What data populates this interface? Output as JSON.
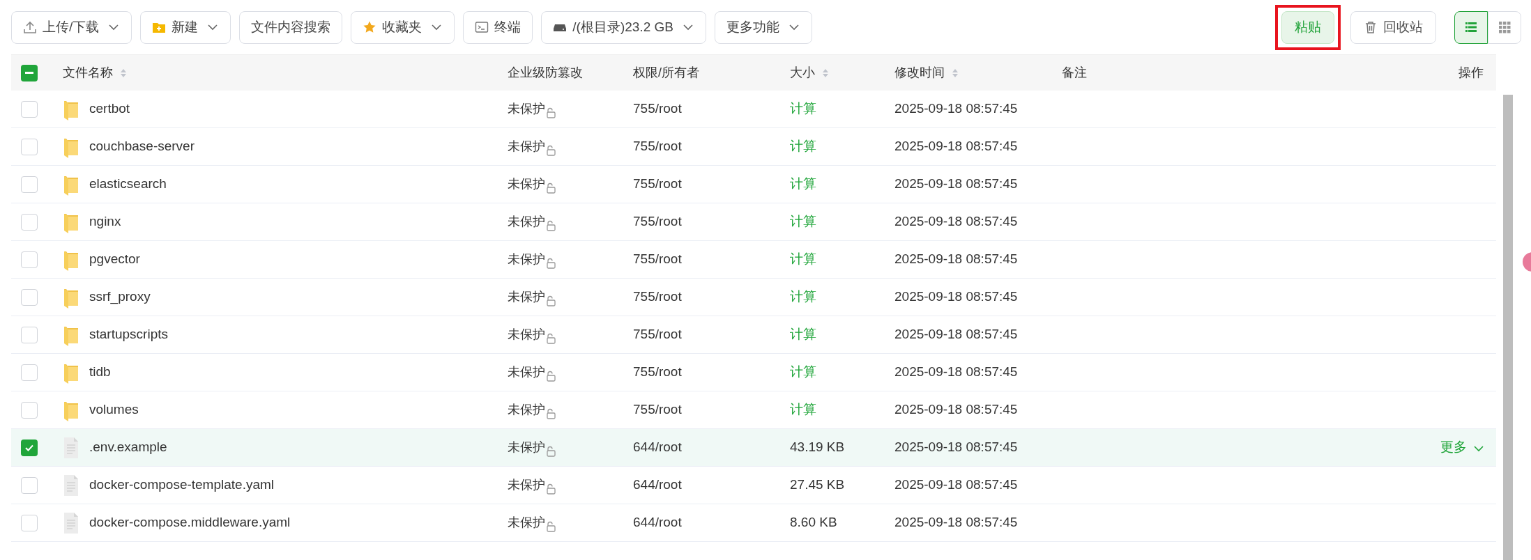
{
  "toolbar": {
    "left": [
      {
        "kind": "upload",
        "label": "上传/下载",
        "dropdown": true
      },
      {
        "kind": "new",
        "label": "新建",
        "dropdown": true
      },
      {
        "kind": "plain",
        "label": "文件内容搜索",
        "dropdown": false
      },
      {
        "kind": "star",
        "label": "收藏夹",
        "dropdown": true
      },
      {
        "kind": "terminal",
        "label": "终端",
        "dropdown": false
      },
      {
        "kind": "disk",
        "label": "/(根目录)23.2 GB",
        "dropdown": true
      },
      {
        "kind": "plain",
        "label": "更多功能",
        "dropdown": true
      }
    ],
    "paste": {
      "label": "粘贴",
      "highlighted": true
    },
    "trash": {
      "label": "回收站"
    },
    "views": [
      {
        "kind": "list",
        "selected": true
      },
      {
        "kind": "grid",
        "selected": false
      }
    ]
  },
  "table": {
    "select_all": {
      "indeterminate": true
    },
    "columns": [
      {
        "label": "文件名称",
        "sortable": true
      },
      {
        "label": "企业级防篡改",
        "sortable": false
      },
      {
        "label": "权限/所有者",
        "sortable": false
      },
      {
        "label": "大小",
        "sortable": true
      },
      {
        "label": "修改时间",
        "sortable": true
      },
      {
        "label": "备注",
        "sortable": false
      },
      {
        "label": "操作",
        "sortable": false
      }
    ],
    "rows": [
      {
        "kind": "folder",
        "name": "certbot",
        "protection": "未保护",
        "perm": "755/root",
        "size": "计算",
        "size_link": true,
        "modified": "2025-09-18 08:57:45",
        "selected": false
      },
      {
        "kind": "folder",
        "name": "couchbase-server",
        "protection": "未保护",
        "perm": "755/root",
        "size": "计算",
        "size_link": true,
        "modified": "2025-09-18 08:57:45",
        "selected": false
      },
      {
        "kind": "folder",
        "name": "elasticsearch",
        "protection": "未保护",
        "perm": "755/root",
        "size": "计算",
        "size_link": true,
        "modified": "2025-09-18 08:57:45",
        "selected": false
      },
      {
        "kind": "folder",
        "name": "nginx",
        "protection": "未保护",
        "perm": "755/root",
        "size": "计算",
        "size_link": true,
        "modified": "2025-09-18 08:57:45",
        "selected": false
      },
      {
        "kind": "folder",
        "name": "pgvector",
        "protection": "未保护",
        "perm": "755/root",
        "size": "计算",
        "size_link": true,
        "modified": "2025-09-18 08:57:45",
        "selected": false
      },
      {
        "kind": "folder",
        "name": "ssrf_proxy",
        "protection": "未保护",
        "perm": "755/root",
        "size": "计算",
        "size_link": true,
        "modified": "2025-09-18 08:57:45",
        "selected": false
      },
      {
        "kind": "folder",
        "name": "startupscripts",
        "protection": "未保护",
        "perm": "755/root",
        "size": "计算",
        "size_link": true,
        "modified": "2025-09-18 08:57:45",
        "selected": false
      },
      {
        "kind": "folder",
        "name": "tidb",
        "protection": "未保护",
        "perm": "755/root",
        "size": "计算",
        "size_link": true,
        "modified": "2025-09-18 08:57:45",
        "selected": false
      },
      {
        "kind": "folder",
        "name": "volumes",
        "protection": "未保护",
        "perm": "755/root",
        "size": "计算",
        "size_link": true,
        "modified": "2025-09-18 08:57:45",
        "selected": false
      },
      {
        "kind": "file",
        "name": ".env.example",
        "protection": "未保护",
        "perm": "644/root",
        "size": "43.19 KB",
        "size_link": false,
        "modified": "2025-09-18 08:57:45",
        "selected": true,
        "action": "更多"
      },
      {
        "kind": "file",
        "name": "docker-compose-template.yaml",
        "protection": "未保护",
        "perm": "644/root",
        "size": "27.45 KB",
        "size_link": false,
        "modified": "2025-09-18 08:57:45",
        "selected": false
      },
      {
        "kind": "file",
        "name": "docker-compose.middleware.yaml",
        "protection": "未保护",
        "perm": "644/root",
        "size": "8.60 KB",
        "size_link": false,
        "modified": "2025-09-18 08:57:45",
        "selected": false
      }
    ]
  }
}
